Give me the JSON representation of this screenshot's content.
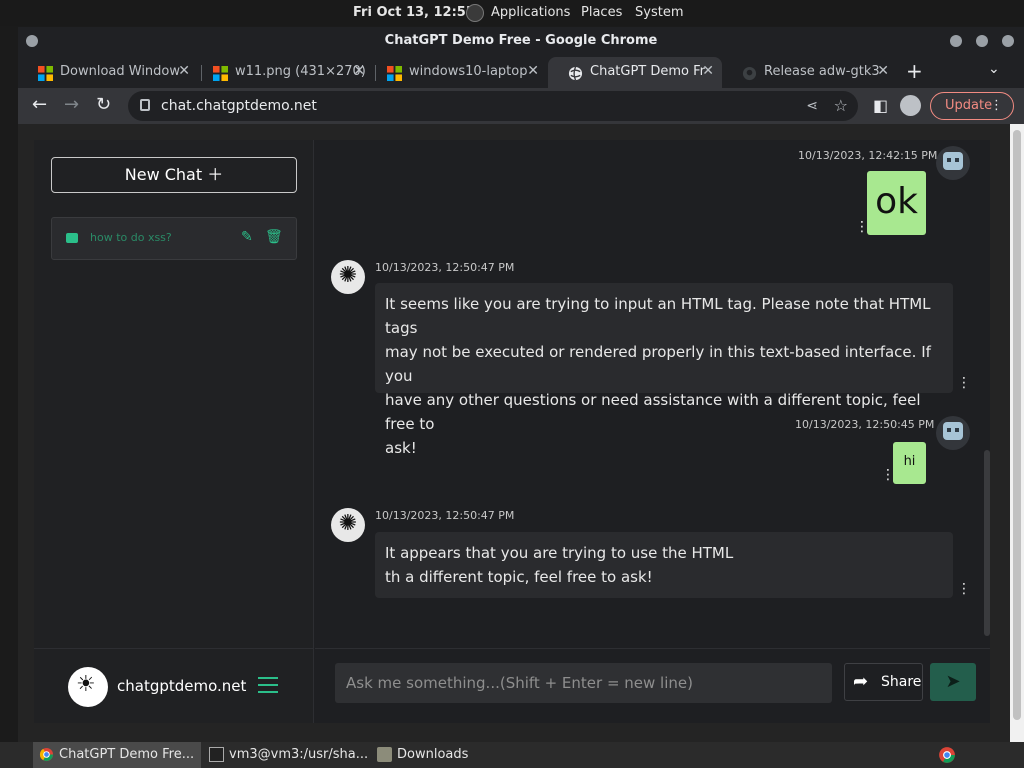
{
  "top_panel": {
    "clock": "Fri Oct 13, 12:55",
    "menus": [
      "Applications",
      "Places",
      "System"
    ]
  },
  "window": {
    "title": "ChatGPT Demo Free - Google Chrome"
  },
  "tabs": [
    {
      "label": "Download Window",
      "icon": "microsoft-logo-icon"
    },
    {
      "label": "w11.png (431×270)",
      "icon": "microsoft-logo-icon"
    },
    {
      "label": "windows10-laptop",
      "icon": "microsoft-logo-icon"
    },
    {
      "label": "ChatGPT Demo Fr",
      "icon": "globe-icon",
      "active": true
    },
    {
      "label": "Release adw-gtk3",
      "icon": "github-icon"
    }
  ],
  "toolbar": {
    "url": "chat.chatgptdemo.net",
    "update_label": "Update"
  },
  "sidebar": {
    "new_chat_label": "New Chat",
    "chats": [
      {
        "title": "how to do xss?"
      }
    ],
    "footer_site": "chatgptdemo.net"
  },
  "messages": [
    {
      "role": "user",
      "timestamp": "10/13/2023, 12:42:15 PM",
      "text": "ok"
    },
    {
      "role": "assistant",
      "timestamp": "10/13/2023, 12:50:47 PM",
      "lines": [
        "It seems like you are trying to input an HTML tag. Please note that HTML tags",
        "may not be executed or rendered properly in this text-based interface. If you",
        "have any other questions or need assistance with a different topic, feel free to",
        "ask!"
      ]
    },
    {
      "role": "user",
      "timestamp": "10/13/2023, 12:50:45 PM",
      "text": "hi"
    },
    {
      "role": "assistant",
      "timestamp": "10/13/2023, 12:50:47 PM",
      "lines": [
        "It appears that you are trying to use the HTML",
        "th a different topic, feel free to ask!"
      ]
    }
  ],
  "composer": {
    "placeholder": "Ask me something...(Shift + Enter = new line)",
    "share_label": "Share"
  },
  "taskbar": {
    "items": [
      "ChatGPT Demo Fre...",
      "vm3@vm3:/usr/sha...",
      "Downloads"
    ]
  },
  "colors": {
    "accent": "#2bbf8a",
    "user_bubble": "#a8e890",
    "send_button": "#235e4c",
    "update_outline": "#f28b82"
  }
}
